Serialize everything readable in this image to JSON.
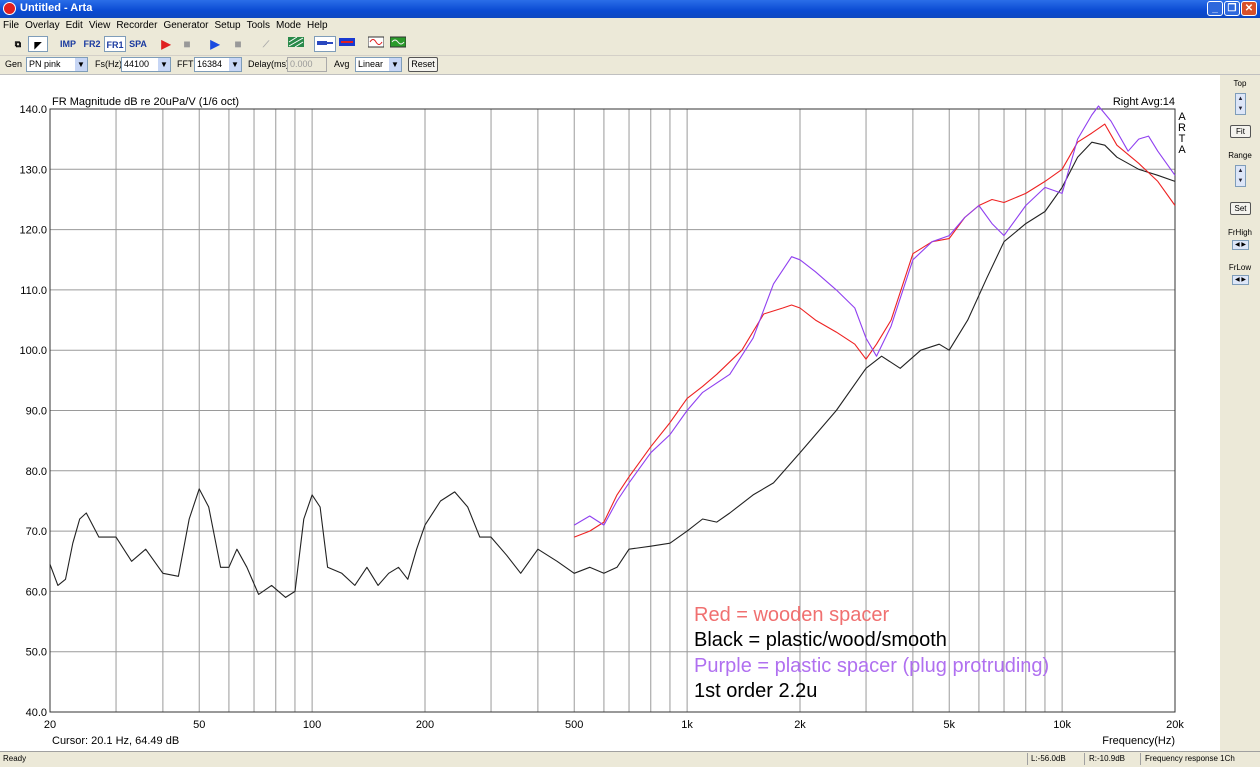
{
  "window": {
    "title": "Untitled - Arta"
  },
  "menu": [
    "File",
    "Overlay",
    "Edit",
    "View",
    "Recorder",
    "Generator",
    "Setup",
    "Tools",
    "Mode",
    "Help"
  ],
  "toolbar": {
    "imp": "IMP",
    "fr2": "FR2",
    "fr1": "FR1",
    "spa": "SPA"
  },
  "genbar": {
    "gen_label": "Gen",
    "gen_value": "PN pink",
    "fs_label": "Fs(Hz)",
    "fs_value": "44100",
    "fft_label": "FFT",
    "fft_value": "16384",
    "delay_label": "Delay(ms)",
    "delay_value": "0.000",
    "avg_label": "Avg",
    "avg_value": "Linear",
    "reset_label": "Reset"
  },
  "plot": {
    "title": "FR Magnitude dB re 20uPa/V (1/6 oct)",
    "top_right": "Right  Avg:14",
    "brand": [
      "A",
      "R",
      "T",
      "A"
    ],
    "cursor": "Cursor:   20.1 Hz, 64.49 dB",
    "xlabel": "Frequency(Hz)",
    "legend": [
      {
        "text": "Red = wooden spacer",
        "color": "#f07070"
      },
      {
        "text": "Black = plastic/wood/smooth",
        "color": "#000000"
      },
      {
        "text": "Purple = plastic spacer (plug protruding)",
        "color": "#b070f0"
      },
      {
        "text": "1st order 2.2u",
        "color": "#000000"
      }
    ]
  },
  "side": {
    "top": "Top",
    "fit": "Fit",
    "range": "Range",
    "set": "Set",
    "frhigh": "FrHigh",
    "frlow": "FrLow"
  },
  "status": {
    "ready": "Ready",
    "l": "L:-56.0dB",
    "r": "R:-10.9dB",
    "mode": "Frequency response 1Ch"
  },
  "chart_data": {
    "type": "line",
    "title": "FR Magnitude dB re 20uPa/V (1/6 oct)",
    "xlabel": "Frequency(Hz)",
    "xscale": "log",
    "xlim": [
      20,
      20000
    ],
    "ylim": [
      40,
      140
    ],
    "grid": true,
    "x_ticks": [
      {
        "v": 20,
        "label": "20"
      },
      {
        "v": 50,
        "label": "50"
      },
      {
        "v": 100,
        "label": "100"
      },
      {
        "v": 200,
        "label": "200"
      },
      {
        "v": 500,
        "label": "500"
      },
      {
        "v": 1000,
        "label": "1k"
      },
      {
        "v": 2000,
        "label": "2k"
      },
      {
        "v": 5000,
        "label": "5k"
      },
      {
        "v": 10000,
        "label": "10k"
      },
      {
        "v": 20000,
        "label": "20k"
      }
    ],
    "y_ticks": [
      {
        "v": 40,
        "label": "40.0"
      },
      {
        "v": 50,
        "label": "50.0"
      },
      {
        "v": 60,
        "label": "60.0"
      },
      {
        "v": 70,
        "label": "70.0"
      },
      {
        "v": 80,
        "label": "80.0"
      },
      {
        "v": 90,
        "label": "90.0"
      },
      {
        "v": 100,
        "label": "100.0"
      },
      {
        "v": 110,
        "label": "110.0"
      },
      {
        "v": 120,
        "label": "120.0"
      },
      {
        "v": 130,
        "label": "130.0"
      },
      {
        "v": 140,
        "label": "140.0"
      }
    ],
    "series": [
      {
        "color": "#222222",
        "points": [
          [
            20,
            64.5
          ],
          [
            21,
            61
          ],
          [
            22,
            62
          ],
          [
            23,
            68
          ],
          [
            24,
            72
          ],
          [
            25,
            73
          ],
          [
            27,
            69
          ],
          [
            30,
            69
          ],
          [
            33,
            65
          ],
          [
            36,
            67
          ],
          [
            40,
            63
          ],
          [
            44,
            62.5
          ],
          [
            47,
            72
          ],
          [
            50,
            77
          ],
          [
            53,
            74
          ],
          [
            57,
            64
          ],
          [
            60,
            64
          ],
          [
            63,
            67
          ],
          [
            67,
            64
          ],
          [
            72,
            59.5
          ],
          [
            78,
            61
          ],
          [
            85,
            59
          ],
          [
            90,
            60
          ],
          [
            95,
            72
          ],
          [
            100,
            76
          ],
          [
            105,
            74
          ],
          [
            110,
            64
          ],
          [
            120,
            63
          ],
          [
            130,
            61
          ],
          [
            140,
            64
          ],
          [
            150,
            61
          ],
          [
            160,
            63
          ],
          [
            170,
            64
          ],
          [
            180,
            62
          ],
          [
            190,
            67
          ],
          [
            200,
            71
          ],
          [
            220,
            75
          ],
          [
            240,
            76.5
          ],
          [
            260,
            74
          ],
          [
            280,
            69
          ],
          [
            300,
            69
          ],
          [
            330,
            66
          ],
          [
            360,
            63
          ],
          [
            400,
            67
          ],
          [
            450,
            65
          ],
          [
            500,
            63
          ],
          [
            550,
            64
          ],
          [
            600,
            63
          ],
          [
            650,
            64
          ],
          [
            700,
            67
          ],
          [
            800,
            67.5
          ],
          [
            900,
            68
          ],
          [
            1000,
            70
          ],
          [
            1100,
            72
          ],
          [
            1200,
            71.5
          ],
          [
            1300,
            73
          ],
          [
            1500,
            76
          ],
          [
            1700,
            78
          ],
          [
            2000,
            83
          ],
          [
            2500,
            90
          ],
          [
            3000,
            97
          ],
          [
            3300,
            99
          ],
          [
            3700,
            97
          ],
          [
            4200,
            100
          ],
          [
            4700,
            101
          ],
          [
            5000,
            100
          ],
          [
            5600,
            105
          ],
          [
            6300,
            112
          ],
          [
            7000,
            118
          ],
          [
            8000,
            121
          ],
          [
            9000,
            123
          ],
          [
            10000,
            127
          ],
          [
            11000,
            132
          ],
          [
            12000,
            134.5
          ],
          [
            13000,
            134
          ],
          [
            14000,
            132
          ],
          [
            16000,
            130
          ],
          [
            18000,
            129
          ],
          [
            20000,
            128
          ]
        ]
      },
      {
        "color": "#ee2222",
        "points": [
          [
            500,
            69
          ],
          [
            550,
            70
          ],
          [
            600,
            71.5
          ],
          [
            650,
            76
          ],
          [
            700,
            79
          ],
          [
            800,
            84
          ],
          [
            900,
            88
          ],
          [
            1000,
            92
          ],
          [
            1100,
            94
          ],
          [
            1200,
            96
          ],
          [
            1400,
            100
          ],
          [
            1600,
            106
          ],
          [
            1800,
            107
          ],
          [
            1900,
            107.5
          ],
          [
            2000,
            107
          ],
          [
            2200,
            105
          ],
          [
            2500,
            103
          ],
          [
            2800,
            101
          ],
          [
            3000,
            98.5
          ],
          [
            3200,
            101
          ],
          [
            3500,
            105
          ],
          [
            4000,
            116
          ],
          [
            4500,
            118
          ],
          [
            5000,
            118.5
          ],
          [
            5500,
            122
          ],
          [
            6000,
            124
          ],
          [
            6500,
            125
          ],
          [
            7000,
            124.5
          ],
          [
            8000,
            126
          ],
          [
            9000,
            128
          ],
          [
            10000,
            130
          ],
          [
            11000,
            134.5
          ],
          [
            12000,
            136
          ],
          [
            13000,
            137.5
          ],
          [
            14000,
            134
          ],
          [
            16000,
            131
          ],
          [
            18000,
            128
          ],
          [
            20000,
            124
          ]
        ]
      },
      {
        "color": "#9040f0",
        "points": [
          [
            500,
            71
          ],
          [
            550,
            72.5
          ],
          [
            600,
            71
          ],
          [
            650,
            75
          ],
          [
            700,
            78
          ],
          [
            800,
            83
          ],
          [
            900,
            86
          ],
          [
            1000,
            90
          ],
          [
            1100,
            93
          ],
          [
            1300,
            96
          ],
          [
            1500,
            102
          ],
          [
            1700,
            111
          ],
          [
            1900,
            115.5
          ],
          [
            2000,
            115
          ],
          [
            2200,
            113
          ],
          [
            2500,
            110
          ],
          [
            2800,
            107
          ],
          [
            3000,
            102
          ],
          [
            3200,
            99
          ],
          [
            3500,
            104
          ],
          [
            4000,
            115
          ],
          [
            4500,
            118
          ],
          [
            5000,
            119
          ],
          [
            5500,
            122
          ],
          [
            6000,
            124
          ],
          [
            6500,
            121
          ],
          [
            7000,
            119
          ],
          [
            8000,
            124
          ],
          [
            9000,
            127
          ],
          [
            10000,
            126
          ],
          [
            11000,
            135
          ],
          [
            12000,
            139
          ],
          [
            12500,
            140.5
          ],
          [
            13500,
            138
          ],
          [
            15000,
            133
          ],
          [
            16000,
            135
          ],
          [
            17000,
            135.5
          ],
          [
            18000,
            133
          ],
          [
            20000,
            129
          ]
        ]
      }
    ]
  }
}
